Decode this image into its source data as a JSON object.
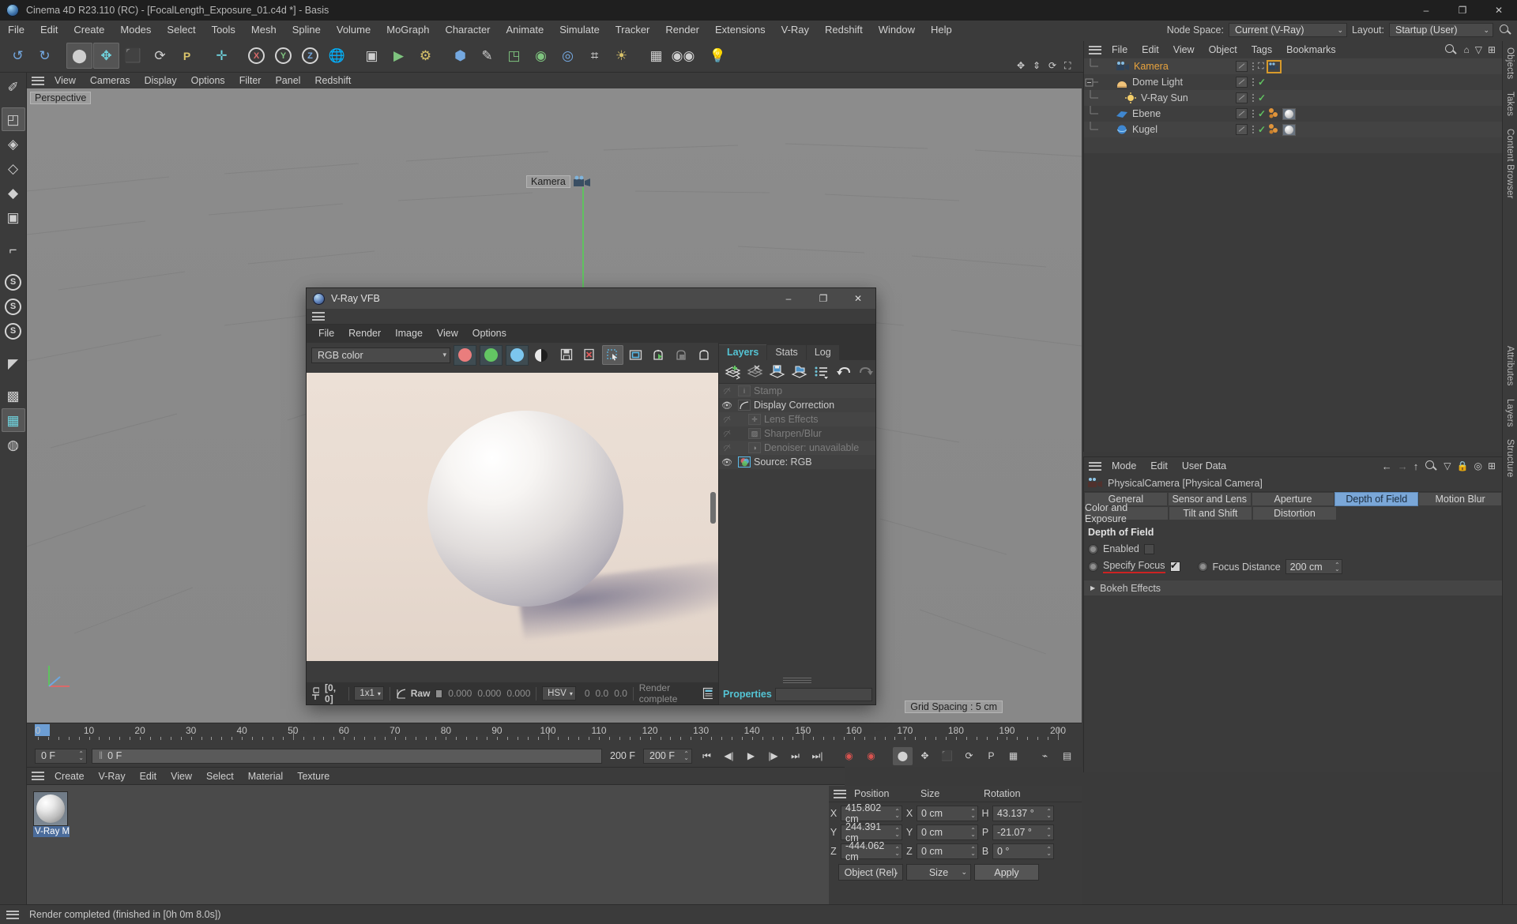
{
  "window": {
    "title": "Cinema 4D R23.110 (RC) - [FocalLength_Exposure_01.c4d *] - Basis",
    "minimize": "–",
    "maximize": "❐",
    "close": "✕"
  },
  "main_menu": {
    "items": [
      "File",
      "Edit",
      "Create",
      "Modes",
      "Select",
      "Tools",
      "Mesh",
      "Spline",
      "Volume",
      "MoGraph",
      "Character",
      "Animate",
      "Simulate",
      "Tracker",
      "Render",
      "Extensions",
      "V-Ray",
      "Redshift",
      "Window",
      "Help"
    ],
    "node_space_label": "Node Space:",
    "node_space_value": "Current (V-Ray)",
    "layout_label": "Layout:",
    "layout_value": "Startup (User)"
  },
  "viewport": {
    "menu": [
      "View",
      "Cameras",
      "Display",
      "Options",
      "Filter",
      "Panel",
      "Redshift"
    ],
    "projection_label": "Perspective",
    "camera_label": "Kamera",
    "grid_spacing": "Grid Spacing : 5 cm"
  },
  "timeline": {
    "ticks": [
      0,
      10,
      20,
      30,
      40,
      50,
      60,
      70,
      80,
      90,
      100,
      110,
      120,
      130,
      140,
      150,
      160,
      170,
      180,
      190,
      200
    ],
    "current_frame_field": "0 F",
    "strip_frame": "0 F",
    "end_frame_a": "200 F",
    "end_frame_b": "200 F",
    "right_frame": "0 F"
  },
  "material_manager": {
    "menu": [
      "Create",
      "V-Ray",
      "Edit",
      "View",
      "Select",
      "Material",
      "Texture"
    ],
    "materials": [
      {
        "name": "V-Ray M"
      }
    ]
  },
  "coordinates": {
    "headers": [
      "Position",
      "Size",
      "Rotation"
    ],
    "rows": [
      {
        "pos_axis": "X",
        "pos": "415.802 cm",
        "size_axis": "X",
        "size": "0 cm",
        "rot_axis": "H",
        "rot": "43.137 °"
      },
      {
        "pos_axis": "Y",
        "pos": "244.391 cm",
        "size_axis": "Y",
        "size": "0 cm",
        "rot_axis": "P",
        "rot": "-21.07 °"
      },
      {
        "pos_axis": "Z",
        "pos": "-444.062 cm",
        "size_axis": "Z",
        "size": "0 cm",
        "rot_axis": "B",
        "rot": "0 °"
      }
    ],
    "mode_dropdown": "Object (Rel)",
    "size_dropdown": "Size",
    "apply_button": "Apply"
  },
  "object_manager": {
    "menu": [
      "File",
      "Edit",
      "View",
      "Object",
      "Tags",
      "Bookmarks"
    ],
    "objects": [
      {
        "name": "Kamera",
        "selected": true,
        "indent": 1,
        "check": false,
        "tag": "camera"
      },
      {
        "name": "Dome Light",
        "selected": false,
        "indent": 0,
        "check": true,
        "tag": ""
      },
      {
        "name": "V-Ray Sun",
        "selected": false,
        "indent": 2,
        "check": true,
        "tag": ""
      },
      {
        "name": "Ebene",
        "selected": false,
        "indent": 1,
        "check": true,
        "tag": "material"
      },
      {
        "name": "Kugel",
        "selected": false,
        "indent": 1,
        "check": true,
        "tag": "material"
      }
    ]
  },
  "attributes": {
    "menu": [
      "Mode",
      "Edit",
      "User Data"
    ],
    "object_title": "PhysicalCamera [Physical Camera]",
    "tabs_row1": [
      "General",
      "Sensor and Lens",
      "Aperture",
      "Depth of Field",
      "Motion Blur"
    ],
    "tabs_row2": [
      "Color and Exposure",
      "Tilt and Shift",
      "Distortion"
    ],
    "active_tab": "Depth of Field",
    "section_title": "Depth of Field",
    "enabled_label": "Enabled",
    "enabled_checked": false,
    "specify_focus_label": "Specify Focus",
    "specify_focus_checked": true,
    "focus_distance_label": "Focus Distance",
    "focus_distance_value": "200 cm",
    "bokeh_label": "Bokeh Effects"
  },
  "right_tabs": [
    "Objects",
    "Takes",
    "Content Browser",
    "Attributes",
    "Layers",
    "Structure"
  ],
  "status_bar": {
    "text": "Render completed (finished in [0h  0m  8.0s])"
  },
  "vfb": {
    "title": "V-Ray VFB",
    "menu": [
      "File",
      "Render",
      "Image",
      "View",
      "Options"
    ],
    "channel_dropdown": "RGB color",
    "channel_buttons": [
      "red-channel",
      "green-channel",
      "blue-channel",
      "alpha-channel"
    ],
    "channel_colors": [
      "#ea7d7d",
      "#63c563",
      "#7cc6ee"
    ],
    "toolbar_icons": [
      "save-image-icon",
      "clear-image-icon",
      "region-render-icon",
      "frame-region-icon",
      "render-last-icon",
      "stop-render-icon",
      "render-icon"
    ],
    "tabs": [
      "Layers",
      "Stats",
      "Log"
    ],
    "active_tab": "Layers",
    "layer_tools": [
      "add-layer-icon",
      "delete-layer-icon",
      "save-layers-icon",
      "load-layers-icon",
      "layer-presets-icon",
      "undo-icon",
      "redo-icon"
    ],
    "layers": [
      {
        "name": "Stamp",
        "visible": false,
        "indent": 1,
        "icon": "i"
      },
      {
        "name": "Display Correction",
        "visible": true,
        "indent": 0,
        "icon": "curve"
      },
      {
        "name": "Lens Effects",
        "visible": false,
        "indent": 1,
        "icon": "plus"
      },
      {
        "name": "Sharpen/Blur",
        "visible": false,
        "indent": 1,
        "icon": "blur"
      },
      {
        "name": "Denoiser: unavailable",
        "visible": false,
        "indent": 1,
        "icon": "half"
      },
      {
        "name": "Source: RGB",
        "visible": true,
        "indent": 0,
        "icon": "rgb"
      }
    ],
    "properties_label": "Properties",
    "status": {
      "pixel_coords": "[0, 0]",
      "zoom": "1x1",
      "raw_label": "Raw",
      "raw_values": [
        "0.000",
        "0.000",
        "0.000"
      ],
      "color_mode": "HSV",
      "hsv_values": [
        "0",
        "0.0",
        "0.0"
      ],
      "render_state": "Render complete"
    }
  }
}
